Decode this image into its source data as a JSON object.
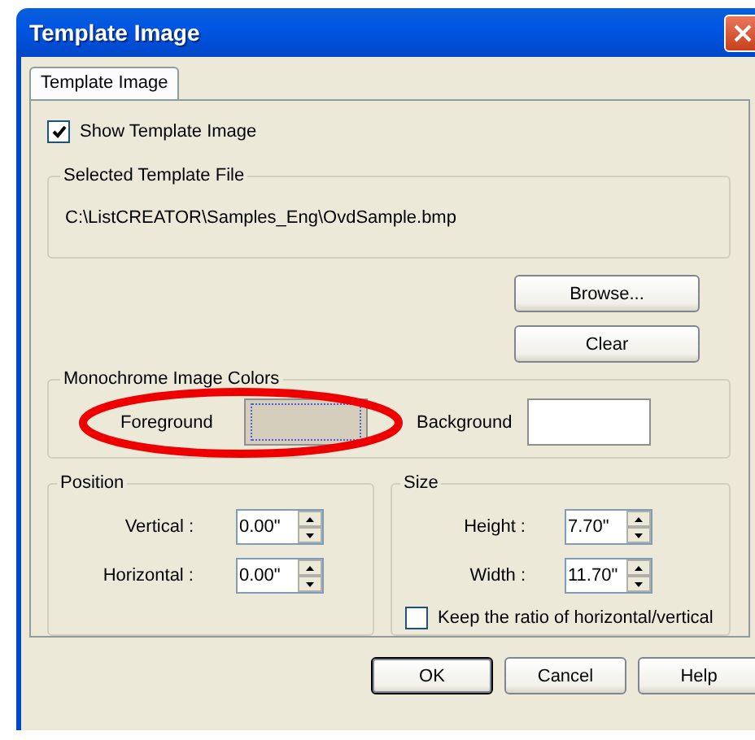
{
  "window": {
    "title": "Template Image"
  },
  "tabs": [
    {
      "label": "Template Image",
      "selected": true
    }
  ],
  "show_template_image": {
    "label": "Show Template Image",
    "checked": true
  },
  "selected_template_file": {
    "legend": "Selected Template File",
    "path": "C:\\ListCREATOR\\Samples_Eng\\OvdSample.bmp"
  },
  "file_buttons": [
    "Browse...",
    "Clear"
  ],
  "monochrome_colors": {
    "legend": "Monochrome Image Colors",
    "swatches": [
      {
        "label": "Foreground",
        "color": "#d6cebc",
        "focused": true
      },
      {
        "label": "Background",
        "color": "#ffffff",
        "focused": false
      }
    ]
  },
  "position": {
    "legend": "Position",
    "fields": [
      {
        "label": "Vertical :",
        "value": "0.00\""
      },
      {
        "label": "Horizontal  :",
        "value": "0.00\""
      }
    ]
  },
  "size": {
    "legend": "Size",
    "fields": [
      {
        "label": "Height :",
        "value": "7.70\""
      },
      {
        "label": "Width :",
        "value": "11.70\""
      }
    ],
    "keep_ratio": {
      "label": "Keep the ratio of horizontal/vertical",
      "checked": false
    }
  },
  "buttons": [
    {
      "label": "OK",
      "default": true
    },
    {
      "label": "Cancel",
      "default": false
    },
    {
      "label": "Help",
      "default": false
    }
  ]
}
